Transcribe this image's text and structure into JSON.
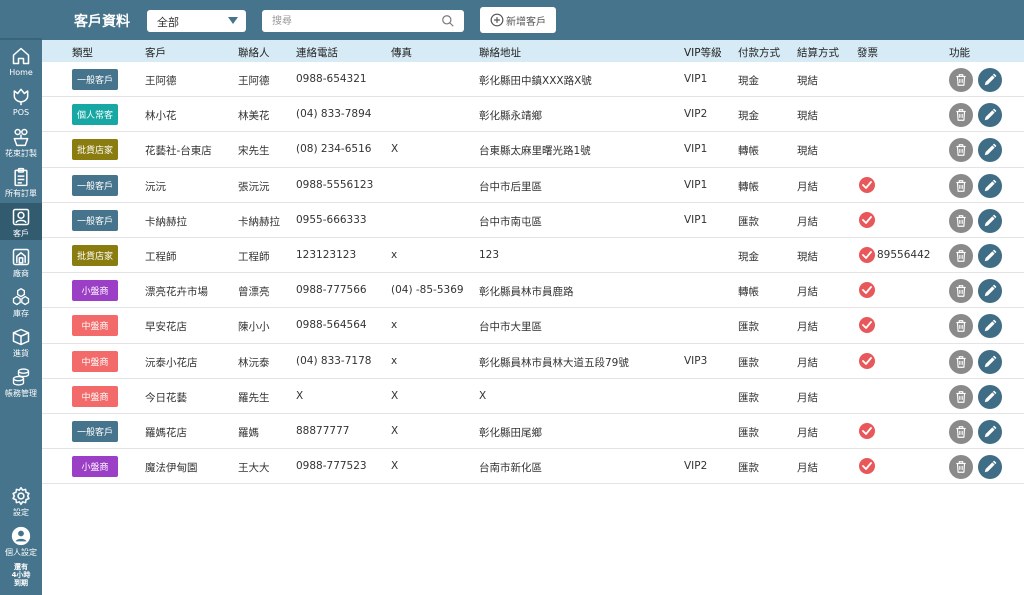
{
  "sidebar": {
    "items": [
      {
        "label": "Home",
        "icon": "home-icon"
      },
      {
        "label": "POS",
        "icon": "flower-icon"
      },
      {
        "label": "花束訂製",
        "icon": "bouquet-icon"
      },
      {
        "label": "所有訂單",
        "icon": "clipboard-icon"
      },
      {
        "label": "客戶",
        "icon": "customer-icon"
      },
      {
        "label": "廠商",
        "icon": "vendor-icon"
      },
      {
        "label": "庫存",
        "icon": "inventory-icon"
      },
      {
        "label": "進貨",
        "icon": "box-icon"
      },
      {
        "label": "帳務管理",
        "icon": "coins-icon"
      },
      {
        "label": "設定",
        "icon": "gear-icon"
      },
      {
        "label": "個人設定",
        "icon": "user-icon"
      }
    ],
    "trial_text": [
      "還有",
      "4小時",
      "到期"
    ]
  },
  "header": {
    "title": "客戶資料",
    "filter_value": "全部",
    "search_placeholder": "搜尋",
    "add_button_label": "新增客戶"
  },
  "table": {
    "columns": [
      "類型",
      "客戶",
      "聯絡人",
      "連絡電話",
      "傳真",
      "聯絡地址",
      "VIP等級",
      "付款方式",
      "結算方式",
      "發票",
      "功能"
    ],
    "badge_colors": {
      "一般客戶": "#46748c",
      "個人常客": "#17a8a3",
      "批貨店家": "#8a7c0f",
      "小盤商": "#9b3fc6",
      "中盤商": "#f26a6a"
    },
    "rows": [
      {
        "type": "一般客戶",
        "customer": "王阿德",
        "contact": "王阿德",
        "phone": "0988-654321",
        "fax": "",
        "address": "彰化縣田中鎮XXX路X號",
        "vip": "VIP1",
        "payment": "現金",
        "settlement": "現結",
        "invoice": false,
        "invoice_no": ""
      },
      {
        "type": "個人常客",
        "customer": "林小花",
        "contact": "林美花",
        "phone": "(04) 833-7894",
        "fax": "",
        "address": "彰化縣永靖鄉",
        "vip": "VIP2",
        "payment": "現金",
        "settlement": "現結",
        "invoice": false,
        "invoice_no": ""
      },
      {
        "type": "批貨店家",
        "customer": "花藝社-台東店",
        "contact": "宋先生",
        "phone": "(08) 234-6516",
        "fax": "X",
        "address": "台東縣太麻里曙光路1號",
        "vip": "VIP1",
        "payment": "轉帳",
        "settlement": "現結",
        "invoice": false,
        "invoice_no": ""
      },
      {
        "type": "一般客戶",
        "customer": "沅沅",
        "contact": "張沅沅",
        "phone": "0988-5556123",
        "fax": "",
        "address": "台中市后里區",
        "vip": "VIP1",
        "payment": "轉帳",
        "settlement": "月結",
        "invoice": true,
        "invoice_no": ""
      },
      {
        "type": "一般客戶",
        "customer": "卡納赫拉",
        "contact": "卡納赫拉",
        "phone": "0955-666333",
        "fax": "",
        "address": "台中市南屯區",
        "vip": "VIP1",
        "payment": "匯款",
        "settlement": "月結",
        "invoice": true,
        "invoice_no": ""
      },
      {
        "type": "批貨店家",
        "customer": "工程師",
        "contact": "工程師",
        "phone": "123123123",
        "fax": "x",
        "address": "123",
        "vip": "",
        "payment": "現金",
        "settlement": "現結",
        "invoice": true,
        "invoice_no": "89556442"
      },
      {
        "type": "小盤商",
        "customer": "漂亮花卉市場",
        "contact": "曾漂亮",
        "phone": "0988-777566",
        "fax": "(04) -85-5369",
        "address": "彰化縣員林市員鹿路",
        "vip": "",
        "payment": "轉帳",
        "settlement": "月結",
        "invoice": true,
        "invoice_no": ""
      },
      {
        "type": "中盤商",
        "customer": "早安花店",
        "contact": "陳小小",
        "phone": "0988-564564",
        "fax": "x",
        "address": "台中市大里區",
        "vip": "",
        "payment": "匯款",
        "settlement": "月結",
        "invoice": true,
        "invoice_no": ""
      },
      {
        "type": "中盤商",
        "customer": "沅泰小花店",
        "contact": "林沅泰",
        "phone": "(04) 833-7178",
        "fax": "x",
        "address": "彰化縣員林市員林大道五段79號",
        "vip": "VIP3",
        "payment": "匯款",
        "settlement": "月結",
        "invoice": true,
        "invoice_no": ""
      },
      {
        "type": "中盤商",
        "customer": "今日花藝",
        "contact": "羅先生",
        "phone": "X",
        "fax": "X",
        "address": "X",
        "vip": "",
        "payment": "匯款",
        "settlement": "月結",
        "invoice": false,
        "invoice_no": ""
      },
      {
        "type": "一般客戶",
        "customer": "羅媽花店",
        "contact": "羅媽",
        "phone": "88877777",
        "fax": "X",
        "address": "彰化縣田尾鄉",
        "vip": "",
        "payment": "匯款",
        "settlement": "月結",
        "invoice": true,
        "invoice_no": ""
      },
      {
        "type": "小盤商",
        "customer": "魔法伊甸園",
        "contact": "王大大",
        "phone": "0988-777523",
        "fax": "X",
        "address": "台南市新化區",
        "vip": "VIP2",
        "payment": "匯款",
        "settlement": "月結",
        "invoice": true,
        "invoice_no": ""
      }
    ]
  }
}
